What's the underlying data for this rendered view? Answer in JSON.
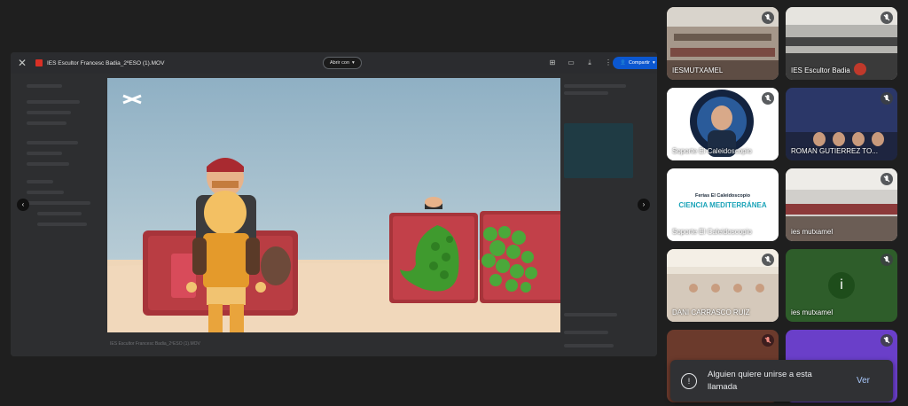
{
  "viewer": {
    "file_title": "IES Escultor Francesc Badia_2ºESO (1).MOV",
    "open_with": "Abrir con",
    "share": "Compartir",
    "bottom_file": "IES Escultor Francesc Badia_2ºESO (1).MOV"
  },
  "participants": [
    {
      "name": "IESMUTXAMEL",
      "muted": true
    },
    {
      "name": "IES Escultor Badia",
      "muted": true
    },
    {
      "name": "Soporte El Caleidoscopio",
      "muted": true
    },
    {
      "name": "ROMAN GUTIERREZ TO...",
      "muted": true
    },
    {
      "name": "Soporte El Caleidoscopio",
      "muted": false
    },
    {
      "name": "ies mutxamel",
      "muted": true
    },
    {
      "name": "DANI CARRASCO RUIZ",
      "muted": true
    },
    {
      "name": "ies mutxamel",
      "muted": true
    },
    {
      "name": "",
      "muted": true
    },
    {
      "name": "",
      "muted": true
    }
  ],
  "slide": {
    "line1": "Ferias El Caleidoscopio",
    "line2": "CIENCIA MEDITERRÁNEA"
  },
  "avatar_letter": "i",
  "toast": {
    "message": "Alguien quiere unirse a esta llamada",
    "action": "Ver",
    "icon_glyph": "!"
  },
  "colors": {
    "share_blue": "#0b57d0",
    "link_blue": "#a8c7fa",
    "tile_green": "#2e5d2a",
    "tile_purple": "#6a3fc9"
  }
}
